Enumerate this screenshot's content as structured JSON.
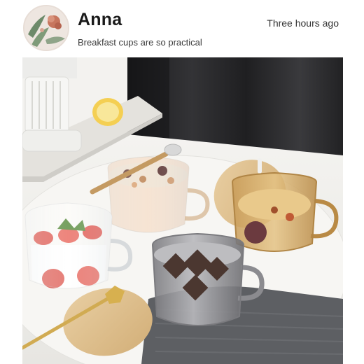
{
  "post": {
    "author": "Anna",
    "time": "Three hours ago",
    "caption": "Breakfast cups are so practical"
  },
  "icons": {
    "avatar": "floral-avatar"
  },
  "colors": {
    "name": "#1a1a1a",
    "time": "#333333",
    "caption": "#3a3a3a",
    "background": "#ffffff"
  }
}
